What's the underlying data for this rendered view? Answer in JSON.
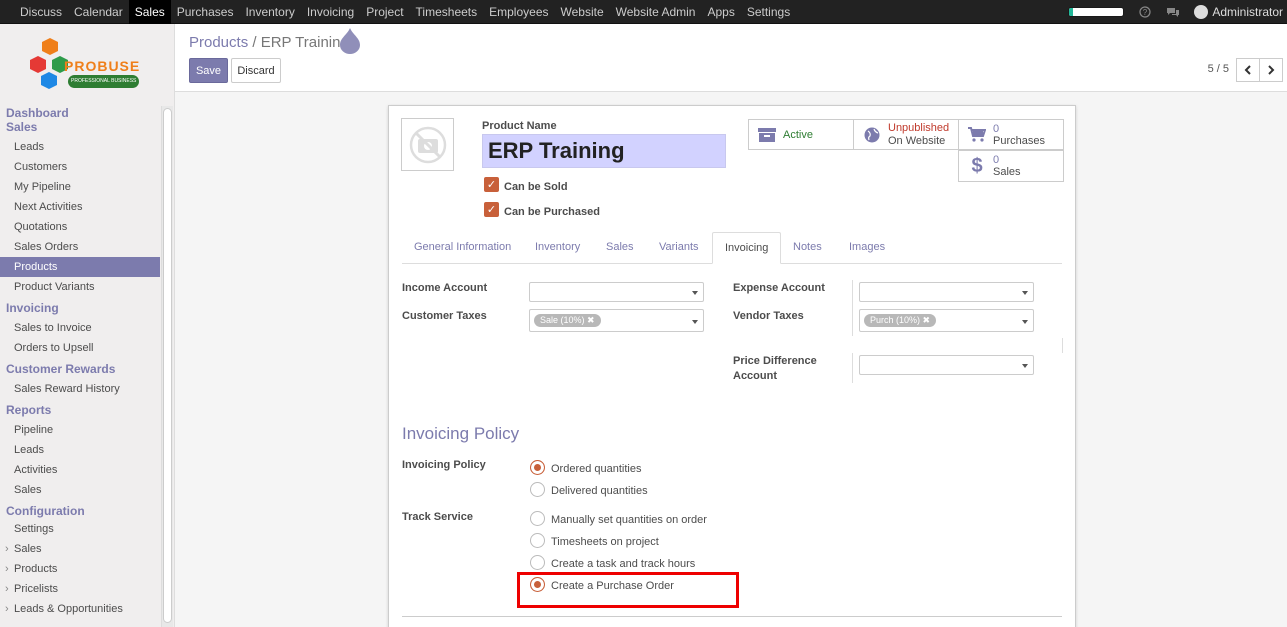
{
  "topbar": {
    "menu": [
      "Discuss",
      "Calendar",
      "Sales",
      "Purchases",
      "Inventory",
      "Invoicing",
      "Project",
      "Timesheets",
      "Employees",
      "Website",
      "Website Admin",
      "Apps",
      "Settings"
    ],
    "active_menu": "Sales",
    "user": "Administrator",
    "progress": 0.07
  },
  "logo": {
    "brand": "PROBUSE",
    "tagline": "PROFESSIONAL BUSINESS"
  },
  "sidebar": {
    "sections": [
      {
        "title": "Dashboard",
        "items": []
      },
      {
        "title": "Sales",
        "items": [
          "Leads",
          "Customers",
          "My Pipeline",
          "Next Activities",
          "Quotations",
          "Sales Orders",
          "Products",
          "Product Variants"
        ]
      },
      {
        "title": "Invoicing",
        "items": [
          "Sales to Invoice",
          "Orders to Upsell"
        ]
      },
      {
        "title": "Customer Rewards",
        "items": [
          "Sales Reward History"
        ]
      },
      {
        "title": "Reports",
        "items": [
          "Pipeline",
          "Leads",
          "Activities",
          "Sales"
        ]
      },
      {
        "title": "Configuration",
        "items": [
          "Settings",
          "Sales",
          "Products",
          "Pricelists",
          "Leads & Opportunities"
        ]
      }
    ],
    "active_item": "Products"
  },
  "control": {
    "breadcrumb_parent": "Products",
    "breadcrumb_sep": "/",
    "breadcrumb_current": "ERP Trainin",
    "save_label": "Save",
    "discard_label": "Discard",
    "pager": "5 / 5"
  },
  "product": {
    "name_label": "Product Name",
    "name": "ERP Training",
    "can_be_sold_label": "Can be Sold",
    "can_be_purchased_label": "Can be Purchased"
  },
  "smart_buttons": {
    "active": "Active",
    "website_status": "Unpublished",
    "website_label": "On Website",
    "purchases_count": "0",
    "purchases_label": "Purchases",
    "sales_count": "0",
    "sales_label": "Sales"
  },
  "tabs": [
    "General Information",
    "Inventory",
    "Sales",
    "Variants",
    "Invoicing",
    "Notes",
    "Images"
  ],
  "active_tab": "Invoicing",
  "invoicing": {
    "income_account_label": "Income Account",
    "customer_taxes_label": "Customer Taxes",
    "customer_tax_tag": "Sale (10%)",
    "expense_account_label": "Expense Account",
    "vendor_taxes_label": "Vendor Taxes",
    "vendor_tax_tag": "Purch (10%)",
    "price_diff_label_1": "Price Difference",
    "price_diff_label_2": "Account"
  },
  "policy": {
    "section_title": "Invoicing Policy",
    "invoicing_policy_label": "Invoicing Policy",
    "invoicing_options": [
      "Ordered quantities",
      "Delivered quantities"
    ],
    "track_service_label": "Track Service",
    "track_options": [
      "Manually set quantities on order",
      "Timesheets on project",
      "Create a task and track hours",
      "Create a Purchase Order"
    ]
  },
  "colors": {
    "brand": "#7c7bad",
    "accent": "#c8603a",
    "highlight": "#e00000"
  }
}
